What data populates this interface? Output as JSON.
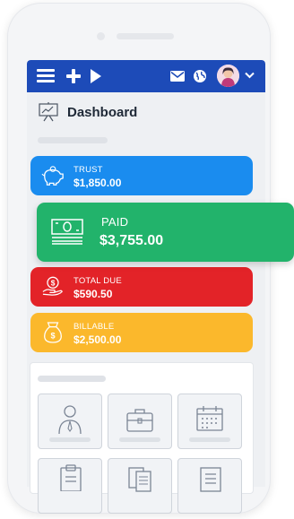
{
  "header": {
    "title": "Dashboard"
  },
  "cards": [
    {
      "label": "TRUST",
      "amount": "$1,850.00",
      "color": "#1a8cef",
      "icon": "piggy-bank-icon"
    },
    {
      "label": "PAID",
      "amount": "$3,755.00",
      "color": "#22b36b",
      "icon": "cash-icon"
    },
    {
      "label": "TOTAL DUE",
      "amount": "$590.50",
      "color": "#e32328",
      "icon": "hand-dollar-icon"
    },
    {
      "label": "BILLABLE",
      "amount": "$2,500.00",
      "color": "#fbb82c",
      "icon": "money-bag-icon"
    }
  ],
  "topbar": {
    "color": "#1d4bb8",
    "icons": [
      "menu-icon",
      "plus-icon",
      "play-icon",
      "mail-icon",
      "globe-icon",
      "avatar",
      "chevron-down-icon"
    ]
  },
  "tiles": [
    "person-icon",
    "briefcase-icon",
    "calendar-icon",
    "clipboard-icon",
    "documents-icon",
    "document-list-icon"
  ]
}
